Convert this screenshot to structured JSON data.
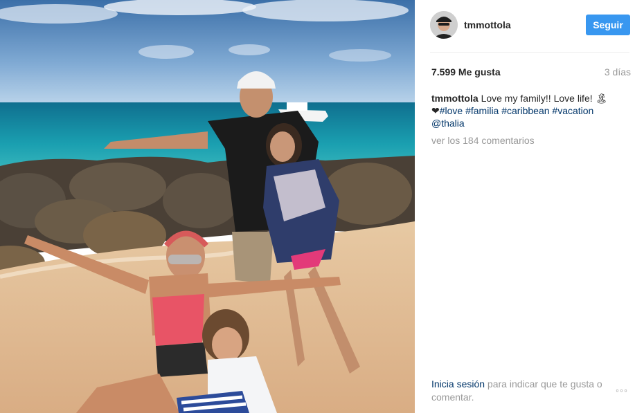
{
  "post": {
    "username": "tmmottola",
    "follow_label": "Seguir",
    "likes": "7.599 Me gusta",
    "time": "3 días",
    "caption": {
      "username": "tmmottola",
      "text_line1": "Love my family!! Love life! 🏝",
      "heart": "❤",
      "hashtags": [
        "#love",
        "#familia",
        "#caribbean",
        "#vacation"
      ],
      "mention": "@thalia"
    },
    "view_comments": "ver los 184 comentarios",
    "footer": {
      "login_link": "Inicia sesión",
      "login_rest": " para indicar que te gusta o comentar."
    },
    "more_label": "◦◦◦"
  },
  "colors": {
    "follow_button": "#3897f0",
    "link": "#003569",
    "muted": "#999999",
    "text": "#262626"
  }
}
